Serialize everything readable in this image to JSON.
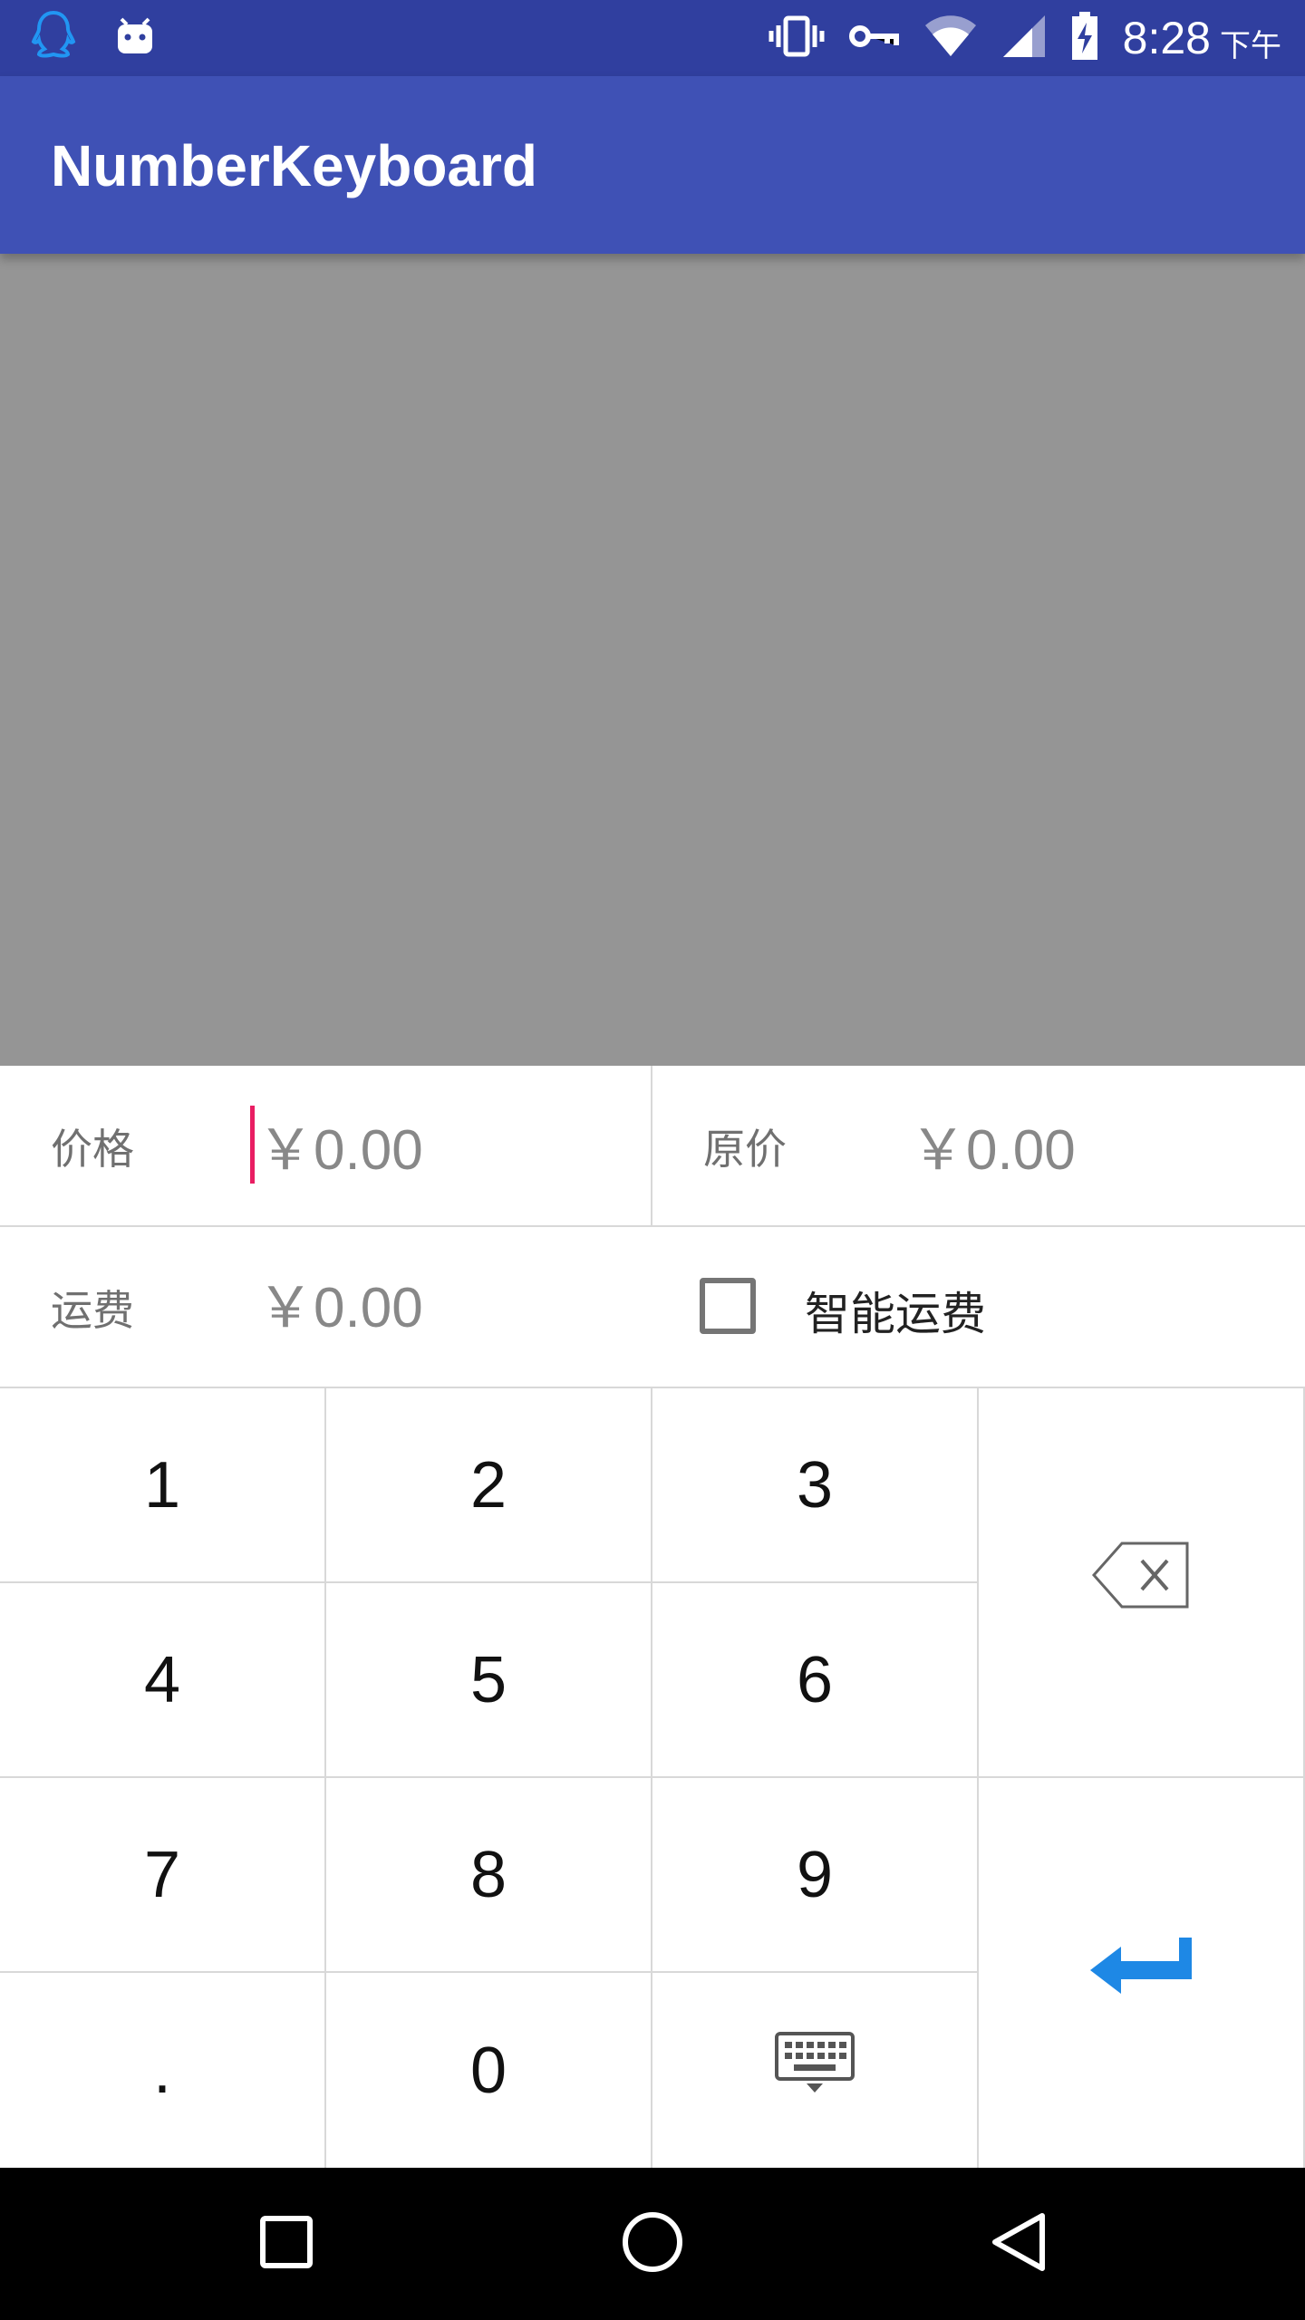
{
  "status_bar": {
    "time": "8:28",
    "ampm": "下午",
    "icons": [
      "qq-icon",
      "android-icon",
      "vibrate-icon",
      "vpn-key-icon",
      "wifi-icon",
      "signal-icon",
      "battery-charging-icon"
    ]
  },
  "app_bar": {
    "title": "NumberKeyboard"
  },
  "form": {
    "price": {
      "label": "价格",
      "value": "￥0.00"
    },
    "original_price": {
      "label": "原价",
      "value": "￥0.00"
    },
    "shipping": {
      "label": "运费",
      "value": "￥0.00"
    },
    "smart_shipping": {
      "label": "智能运费",
      "checked": false
    }
  },
  "keyboard": {
    "keys": [
      "1",
      "2",
      "3",
      "4",
      "5",
      "6",
      "7",
      "8",
      "9",
      ".",
      "0"
    ],
    "accent_color": "#1e88e5",
    "special": [
      "backspace-icon",
      "hide-keyboard-icon",
      "enter-icon"
    ]
  },
  "nav_bar": {
    "buttons": [
      "recents-icon",
      "home-icon",
      "back-icon"
    ]
  },
  "colors": {
    "status_bar": "#303f9f",
    "app_bar": "#3f51b5",
    "cursor": "#e91e63"
  }
}
